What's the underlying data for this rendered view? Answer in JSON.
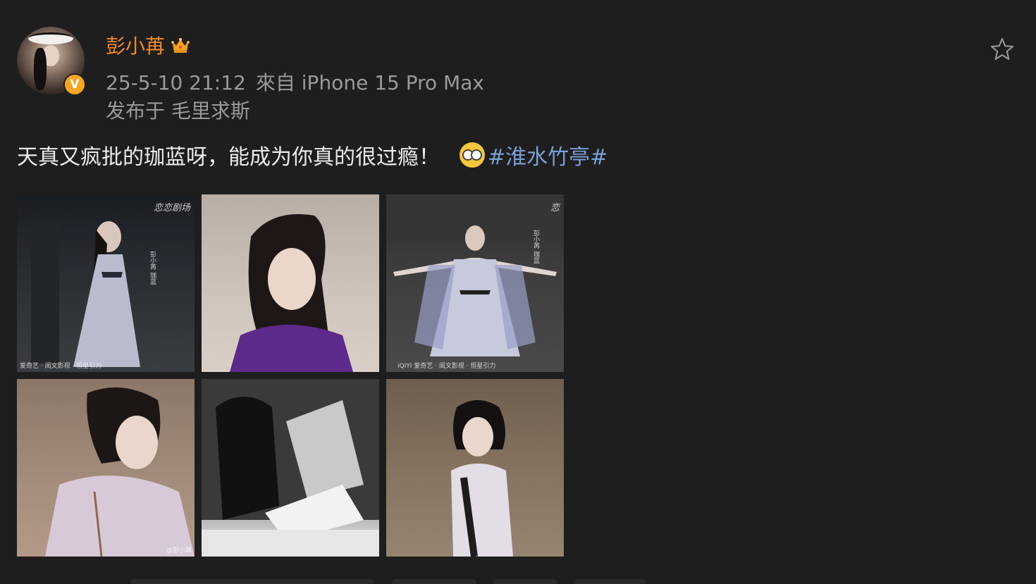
{
  "post": {
    "username": "彭小苒",
    "timestamp": "25-5-10 21:12",
    "source": "來自 iPhone 15 Pro Max",
    "location": "发布于 毛里求斯",
    "text": "天真又疯批的珈蓝呀，能成为你真的很过瘾！",
    "hashtag": "#淮水竹亭#",
    "verified_badge": "V"
  },
  "images": [
    {
      "watermark_top": "恋恋剧场",
      "watermark_bottom": "爱奇艺 · 阅文影视 · 恒星引力",
      "caption": "彭小苒 珈蓝"
    },
    {},
    {
      "watermark_top": "恋",
      "watermark_bottom": "iQIYI 爱奇艺 · 阅文影视 · 恒星引力",
      "caption": "彭小苒 珈蓝"
    },
    {
      "watermark_bottom": "@彭小苒"
    },
    {},
    {}
  ],
  "colors": {
    "background": "#1e1e1e",
    "username": "#f08a2c",
    "meta": "#9a9a9a",
    "hashtag": "#7a9fd6",
    "badge": "#f5a623"
  },
  "icons": {
    "crown": "crown-icon",
    "star": "star-icon",
    "emoji": "glasses-emoji-icon"
  }
}
